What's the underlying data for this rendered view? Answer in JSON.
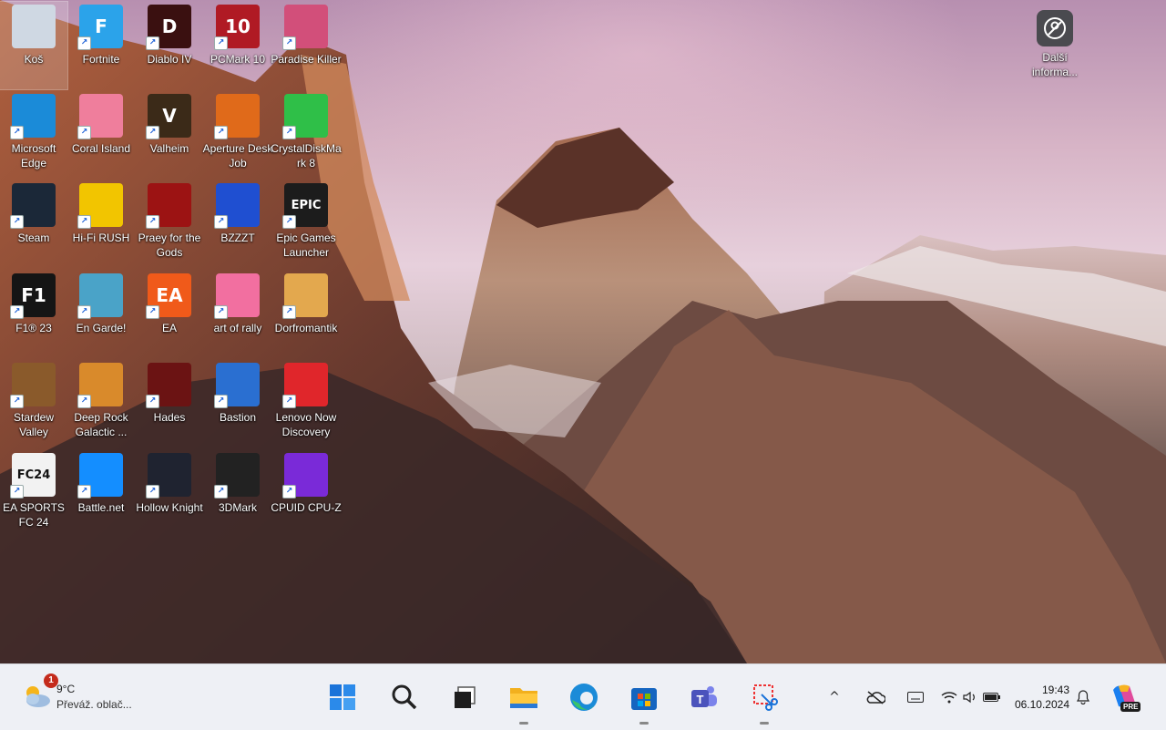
{
  "desktop": {
    "icons": [
      {
        "label": "Koš",
        "icon": "recycle-bin-icon",
        "color": "#cfd8e3",
        "glyph": "",
        "selected": true
      },
      {
        "label": "Fortnite",
        "icon": "fortnite-icon",
        "color": "#2ba3ea",
        "glyph": "F"
      },
      {
        "label": "Diablo IV",
        "icon": "diablo-icon",
        "color": "#3a1010",
        "glyph": "D"
      },
      {
        "label": "PCMark 10",
        "icon": "pcmark-icon",
        "color": "#b01a24",
        "glyph": "10"
      },
      {
        "label": "Paradise Killer",
        "icon": "paradise-killer-icon",
        "color": "#d24f7a",
        "glyph": ""
      },
      {
        "label": "Microsoft Edge",
        "icon": "edge-icon",
        "color": "#1b8bd8",
        "glyph": ""
      },
      {
        "label": "Coral Island",
        "icon": "coral-island-icon",
        "color": "#ef7e9c",
        "glyph": ""
      },
      {
        "label": "Valheim",
        "icon": "valheim-icon",
        "color": "#3b2a18",
        "glyph": "V"
      },
      {
        "label": "Aperture Desk Job",
        "icon": "aperture-icon",
        "color": "#e06a1a",
        "glyph": ""
      },
      {
        "label": "CrystalDiskMark 8",
        "icon": "crystaldisk-icon",
        "color": "#2fbf48",
        "glyph": ""
      },
      {
        "label": "Steam",
        "icon": "steam-icon",
        "color": "#1b2838",
        "glyph": ""
      },
      {
        "label": "Hi-Fi RUSH",
        "icon": "hifi-rush-icon",
        "color": "#f2c500",
        "glyph": ""
      },
      {
        "label": "Praey for the Gods",
        "icon": "praey-icon",
        "color": "#9c1313",
        "glyph": ""
      },
      {
        "label": "BZZZT",
        "icon": "bzzzt-icon",
        "color": "#1f4fd1",
        "glyph": ""
      },
      {
        "label": "Epic Games Launcher",
        "icon": "epic-games-icon",
        "color": "#1c1c1c",
        "glyph": "EPIC"
      },
      {
        "label": "F1® 23",
        "icon": "f1-icon",
        "color": "#151515",
        "glyph": "F1"
      },
      {
        "label": "En Garde!",
        "icon": "en-garde-icon",
        "color": "#4aa3c8",
        "glyph": ""
      },
      {
        "label": "EA",
        "icon": "ea-icon",
        "color": "#f05a1a",
        "glyph": "EA"
      },
      {
        "label": "art of rally",
        "icon": "art-of-rally-icon",
        "color": "#f26fa0",
        "glyph": ""
      },
      {
        "label": "Dorfromantik",
        "icon": "dorfromantik-icon",
        "color": "#e3a84e",
        "glyph": ""
      },
      {
        "label": "Stardew Valley",
        "icon": "stardew-icon",
        "color": "#8a5a2b",
        "glyph": ""
      },
      {
        "label": "Deep Rock Galactic ...",
        "icon": "deep-rock-icon",
        "color": "#d98a2b",
        "glyph": ""
      },
      {
        "label": "Hades",
        "icon": "hades-icon",
        "color": "#6b1313",
        "glyph": ""
      },
      {
        "label": "Bastion",
        "icon": "bastion-icon",
        "color": "#2a6fd1",
        "glyph": ""
      },
      {
        "label": "Lenovo Now Discovery",
        "icon": "lenovo-now-icon",
        "color": "#e0262b",
        "glyph": ""
      },
      {
        "label": "EA SPORTS FC 24",
        "icon": "ea-fc24-icon",
        "color": "#f2f2f2",
        "glyph": "FC24"
      },
      {
        "label": "Battle.net",
        "icon": "battlenet-icon",
        "color": "#148eff",
        "glyph": ""
      },
      {
        "label": "Hollow Knight",
        "icon": "hollow-knight-icon",
        "color": "#1f2330",
        "glyph": ""
      },
      {
        "label": "3DMark",
        "icon": "3dmark-icon",
        "color": "#222222",
        "glyph": ""
      },
      {
        "label": "CPUID CPU-Z",
        "icon": "cpuz-icon",
        "color": "#7a2ad8",
        "glyph": ""
      }
    ],
    "widget": {
      "label": "Další informa...",
      "icon": "user-circle-icon"
    }
  },
  "taskbar": {
    "weather": {
      "badge": "1",
      "temp": "9°C",
      "desc": "Převáž. oblač...",
      "icon": "cloud-sun-icon"
    },
    "apps": [
      {
        "name": "start",
        "icon": "windows-start-icon",
        "running": false
      },
      {
        "name": "search",
        "icon": "search-icon",
        "running": false
      },
      {
        "name": "task-view",
        "icon": "task-view-icon",
        "running": false
      },
      {
        "name": "file-explorer",
        "icon": "folder-icon",
        "running": true
      },
      {
        "name": "edge",
        "icon": "edge-icon",
        "running": false
      },
      {
        "name": "store",
        "icon": "store-icon",
        "running": true
      },
      {
        "name": "teams",
        "icon": "teams-icon",
        "running": false
      },
      {
        "name": "snipping-tool",
        "icon": "snipping-tool-icon",
        "running": true
      }
    ],
    "tray": [
      "chevron-up-icon",
      "onedrive-icon",
      "keyboard-icon",
      "wifi-icon",
      "volume-icon",
      "battery-icon"
    ],
    "clock": {
      "time": "19:43",
      "date": "06.10.2024"
    },
    "copilot": {
      "badge": "PRE"
    }
  }
}
